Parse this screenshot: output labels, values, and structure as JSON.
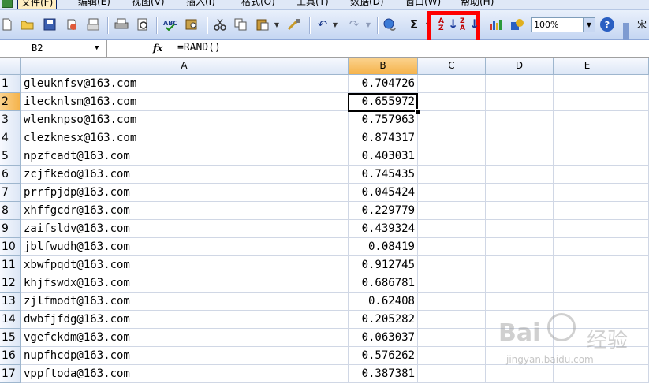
{
  "menubar": {
    "items": [
      "文件(F)",
      "编辑(E)",
      "视图(V)",
      "插入(I)",
      "格式(O)",
      "工具(T)",
      "数据(D)",
      "窗口(W)",
      "帮助(H)"
    ]
  },
  "toolbar": {
    "icons": [
      "new-icon",
      "open-icon",
      "save-icon",
      "permission-icon",
      "email-icon",
      "print-icon",
      "print-preview-icon",
      "spelling-icon",
      "research-icon",
      "cut-icon",
      "copy-icon",
      "paste-icon",
      "format-painter-icon",
      "undo-icon",
      "redo-icon",
      "hyperlink-icon",
      "autosum-icon",
      "sort-ascending-icon",
      "sort-descending-icon",
      "chart-wizard-icon",
      "drawing-icon",
      "help-icon"
    ],
    "zoom": "100%",
    "autosum_glyph": "Σ",
    "help_glyph": "?",
    "extra_label": "宋",
    "highlight_color": "#ff0000"
  },
  "formula_bar": {
    "cell_ref": "B2",
    "fx_label": "fx",
    "formula": "=RAND()"
  },
  "columns": [
    "A",
    "B",
    "C",
    "D",
    "E"
  ],
  "selected_column": "B",
  "selected_row": "2",
  "rows": [
    {
      "n": "1",
      "a": "gleuknfsv@163.com",
      "b": "0.704726"
    },
    {
      "n": "2",
      "a": "ilecknlsm@163.com",
      "b": "0.655972"
    },
    {
      "n": "3",
      "a": "wlenknpso@163.com",
      "b": "0.757963"
    },
    {
      "n": "4",
      "a": "clezknesx@163.com",
      "b": "0.874317"
    },
    {
      "n": "5",
      "a": "npzfcadt@163.com",
      "b": "0.403031"
    },
    {
      "n": "6",
      "a": "zcjfkedo@163.com",
      "b": "0.745435"
    },
    {
      "n": "7",
      "a": "prrfpjdp@163.com",
      "b": "0.045424"
    },
    {
      "n": "8",
      "a": "xhffgcdr@163.com",
      "b": "0.229779"
    },
    {
      "n": "9",
      "a": "zaifsldv@163.com",
      "b": "0.439324"
    },
    {
      "n": "10",
      "a": "jblfwudh@163.com",
      "b": "0.08419"
    },
    {
      "n": "11",
      "a": "xbwfpqdt@163.com",
      "b": "0.912745"
    },
    {
      "n": "12",
      "a": "khjfswdx@163.com",
      "b": "0.686781"
    },
    {
      "n": "13",
      "a": "zjlfmodt@163.com",
      "b": "0.62408"
    },
    {
      "n": "14",
      "a": "dwbfjfdg@163.com",
      "b": "0.205282"
    },
    {
      "n": "15",
      "a": "vgefckdm@163.com",
      "b": "0.063037"
    },
    {
      "n": "16",
      "a": "nupfhcdp@163.com",
      "b": "0.576262"
    },
    {
      "n": "17",
      "a": "vppftoda@163.com",
      "b": "0.387381"
    }
  ],
  "watermark": {
    "brand": "Bai",
    "brand_cn": "经验",
    "url": "jingyan.baidu.com"
  }
}
